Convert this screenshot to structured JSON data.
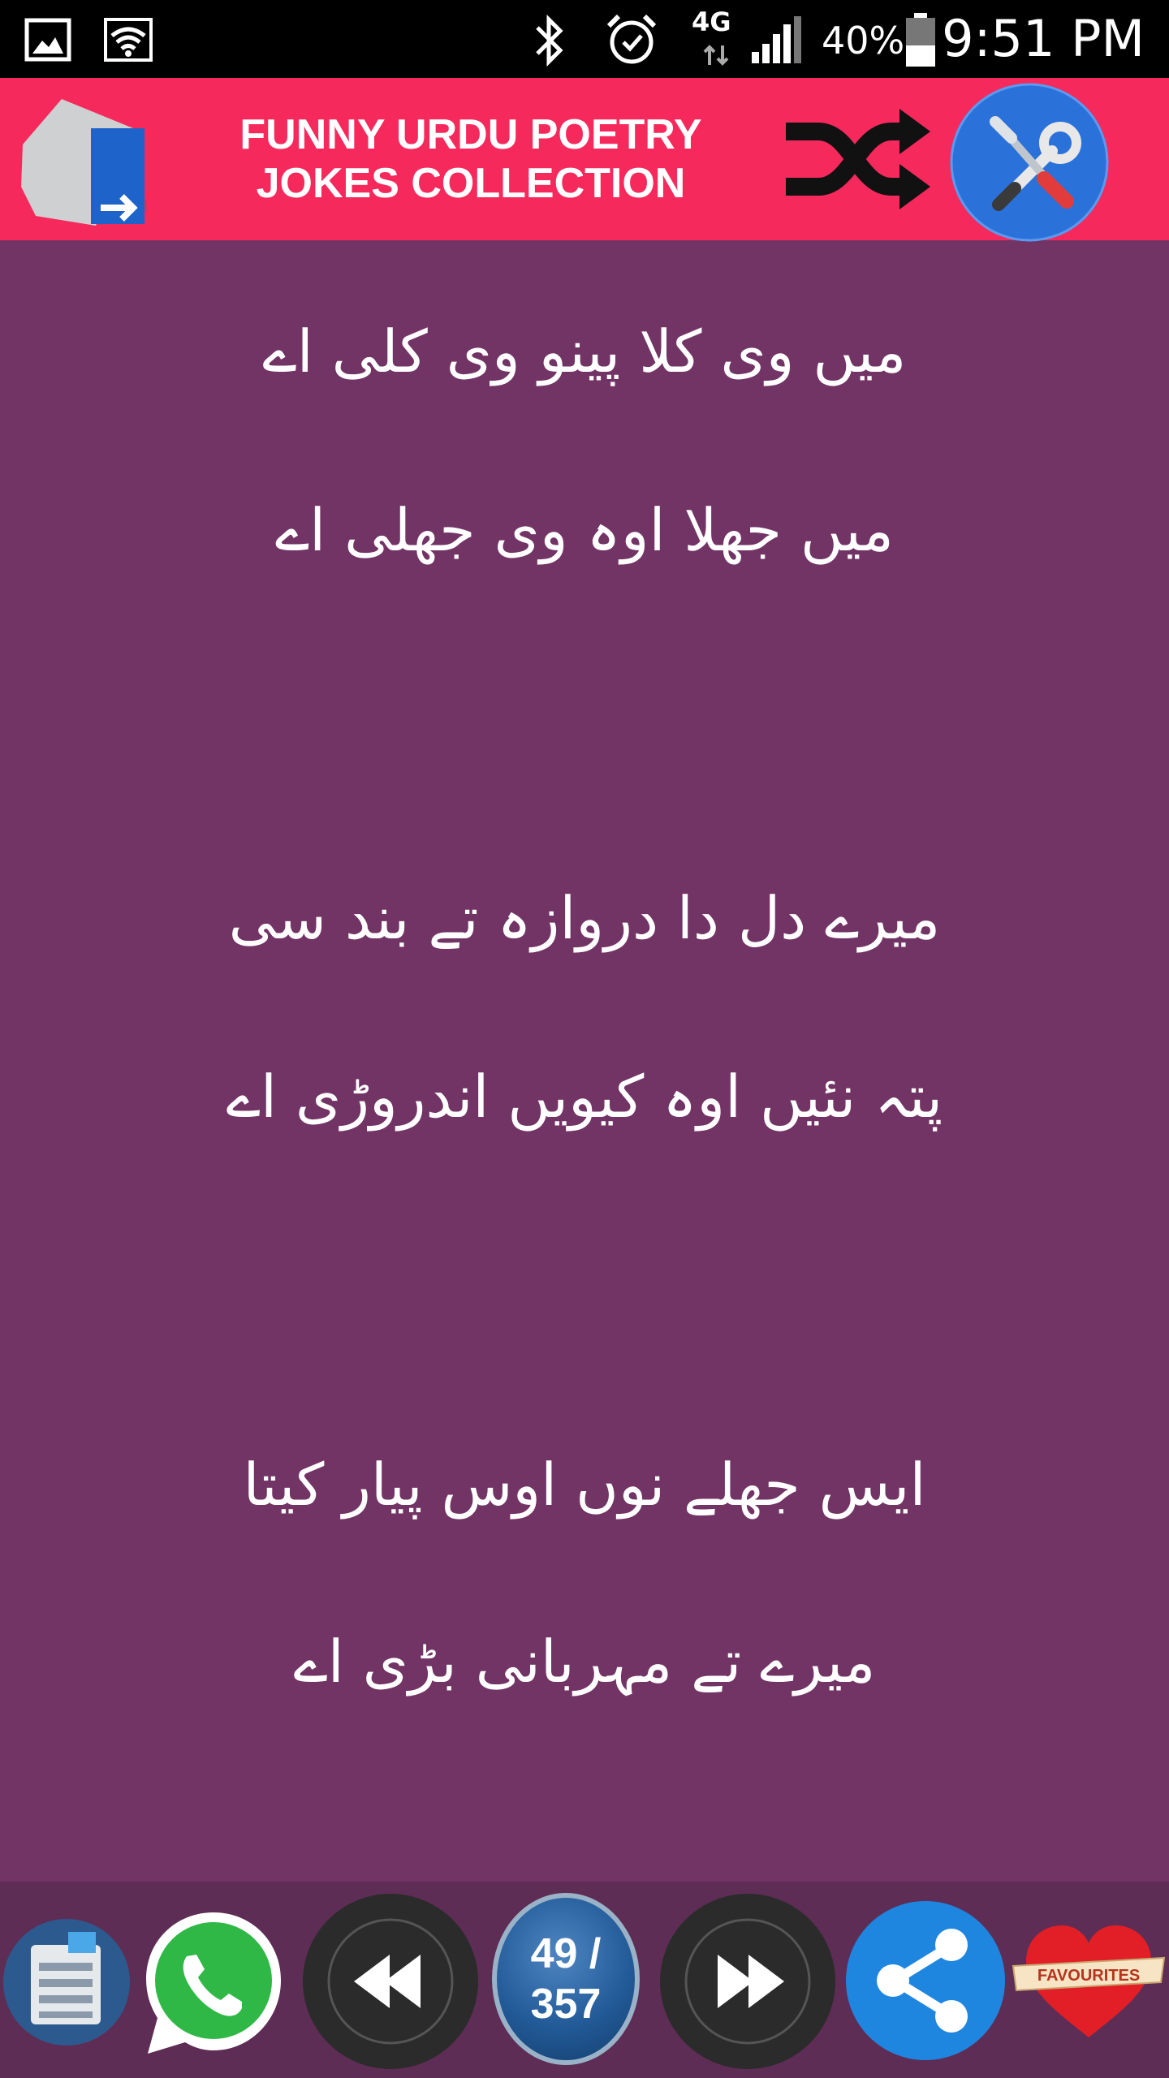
{
  "status_bar": {
    "network": "4G",
    "battery": "40%",
    "time": "9:51 PM"
  },
  "header": {
    "title_line1": "FUNNY URDU POETRY",
    "title_line2": "JOKES COLLECTION",
    "background": "#f6295c"
  },
  "poem": {
    "stanzas": [
      {
        "lines": [
          "میں وی کلا پینو وی کلی اے",
          "میں جھلا اوہ وی جھلی اے"
        ]
      },
      {
        "lines": [
          "میرے دل دا دروازہ تے بند سی",
          "پتہ نئیں اوہ کیویں اندروڑی اے"
        ]
      },
      {
        "lines": [
          "ایس جھلے نوں اوس پیار کیتا",
          "میرے تے مہربانی بڑی اے"
        ]
      }
    ],
    "background": "#723365"
  },
  "toolbar": {
    "counter_current": "49 /",
    "counter_total": "357",
    "favourites_label": "FAVOURITES"
  },
  "icons": {
    "status": [
      "gallery-icon",
      "wifi-icon",
      "bluetooth-icon",
      "alarm-icon",
      "signal-icon",
      "battery-icon"
    ],
    "header": [
      "exit-icon",
      "shuffle-icon",
      "settings-tools-icon"
    ],
    "toolbar": [
      "copy-clipboard-icon",
      "whatsapp-icon",
      "previous-icon",
      "next-icon",
      "share-icon",
      "favourites-heart-icon"
    ]
  }
}
